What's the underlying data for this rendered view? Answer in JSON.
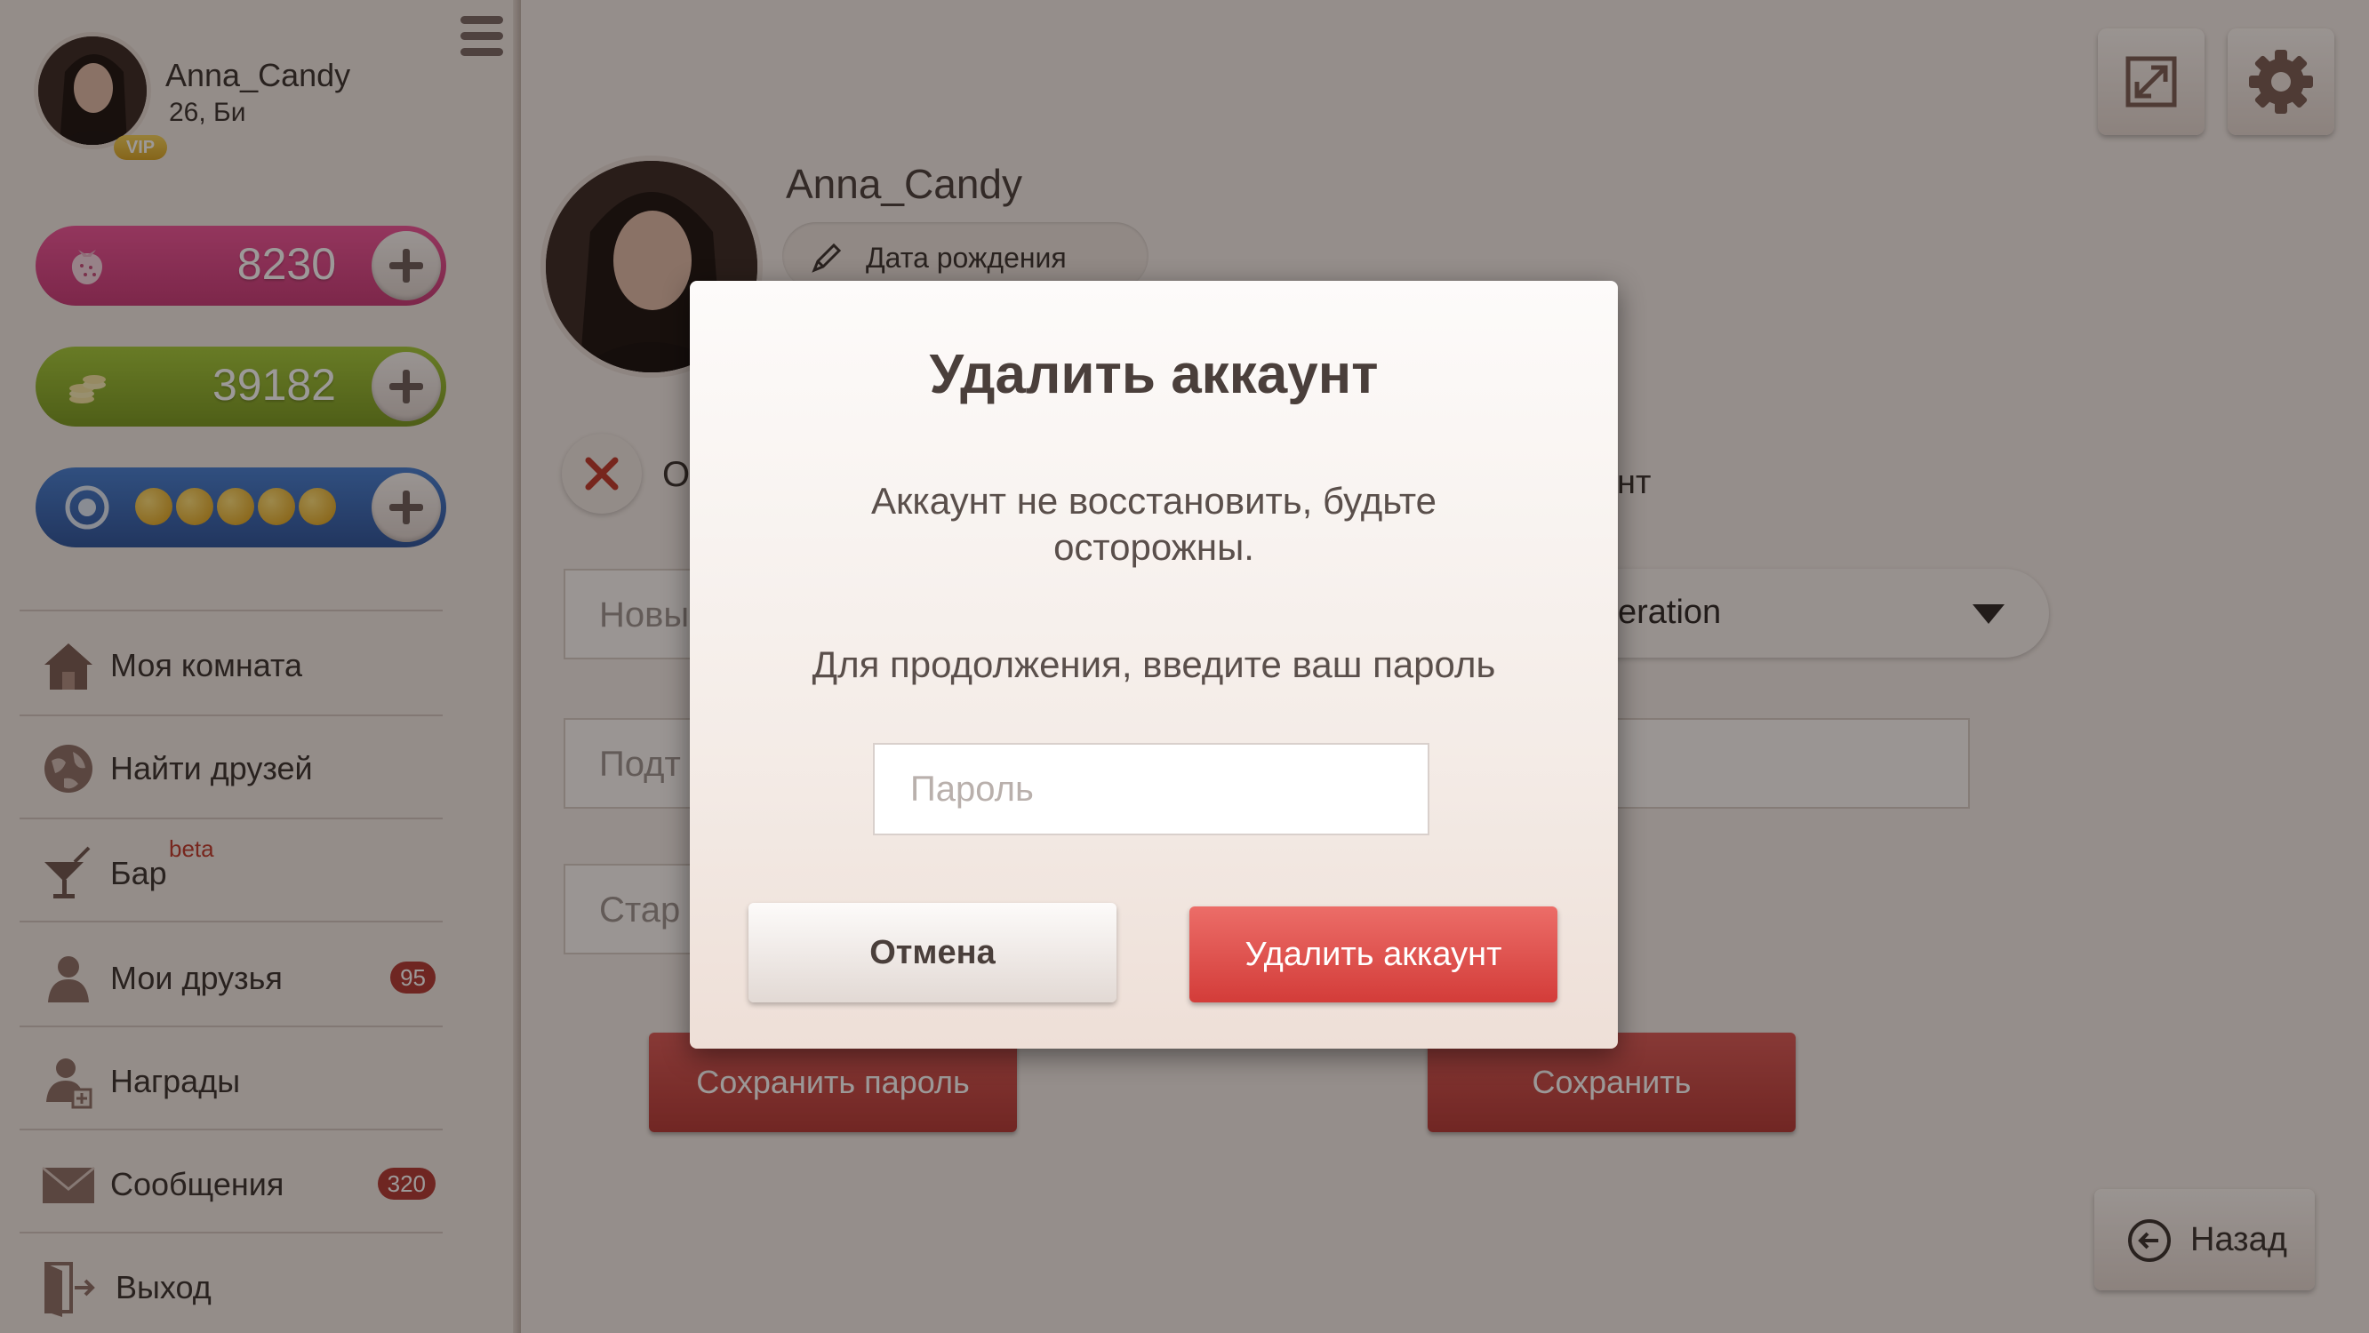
{
  "sidebar": {
    "username": "Anna_Candy",
    "user_info": "26, Би",
    "vip_label": "VIP",
    "currencies": [
      {
        "name": "strawberries",
        "value": "8230",
        "gradient": [
          "#ef4f8e",
          "#b8376d"
        ]
      },
      {
        "name": "coins",
        "value": "39182",
        "gradient": [
          "#9cc23a",
          "#6f8f1f"
        ]
      },
      {
        "name": "tokens",
        "value": "",
        "dots": 5,
        "gradient": [
          "#3f75c8",
          "#2a4f93"
        ]
      }
    ],
    "nav": [
      {
        "id": "my-room",
        "label": "Моя комната",
        "icon": "house-icon"
      },
      {
        "id": "find-friends",
        "label": "Найти друзей",
        "icon": "globe-icon"
      },
      {
        "id": "bar",
        "label": "Бар",
        "icon": "cocktail-icon",
        "sup": "beta"
      },
      {
        "id": "my-friends",
        "label": "Мои друзья",
        "icon": "person-icon",
        "badge": "95"
      },
      {
        "id": "awards",
        "label": "Награды",
        "icon": "award-person-icon"
      },
      {
        "id": "messages",
        "label": "Сообщения",
        "icon": "envelope-icon",
        "badge": "320"
      },
      {
        "id": "logout",
        "label": "Выход",
        "icon": "exit-door-icon"
      }
    ]
  },
  "profile": {
    "name": "Anna_Candy",
    "birthday_label": "Дата рождения",
    "close_partial": "О",
    "right_partial": "унт",
    "select_value": "eration",
    "input_placeholders": [
      "Новы",
      "Подт",
      "Стар"
    ],
    "save_password_label": "Сохранить пароль",
    "save_label": "Сохранить",
    "back_label": "Назад"
  },
  "modal": {
    "title": "Удалить аккаунт",
    "warning": "Аккаунт не восстановить, будьте осторожны.",
    "prompt": "Для продолжения, введите ваш пароль",
    "password_placeholder": "Пароль",
    "cancel_label": "Отмена",
    "delete_label": "Удалить аккаунт"
  },
  "colors": {
    "accent_red": "#d33c39",
    "sidebar_bg": "#f1eae6",
    "badge_red": "#b23a35"
  }
}
